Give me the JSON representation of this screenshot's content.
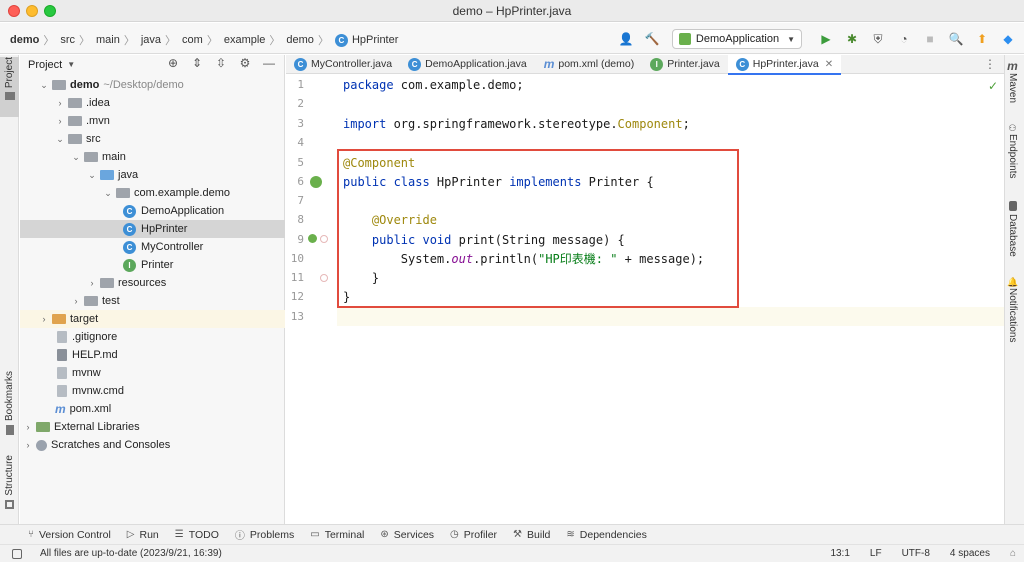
{
  "window": {
    "title": "demo – HpPrinter.java"
  },
  "breadcrumbs": [
    "demo",
    "src",
    "main",
    "java",
    "com",
    "example",
    "demo"
  ],
  "breadcrumb_file": "HpPrinter",
  "toolbar": {
    "run_config": "DemoApplication"
  },
  "left_strip": {
    "project": "Project",
    "bookmarks": "Bookmarks",
    "structure": "Structure"
  },
  "project_panel": {
    "title": "Project",
    "tree": [
      {
        "label": "demo",
        "extra": "~/Desktop/demo"
      },
      {
        "label": ".idea"
      },
      {
        "label": ".mvn"
      },
      {
        "label": "src"
      },
      {
        "label": "main"
      },
      {
        "label": "java"
      },
      {
        "label": "com.example.demo"
      },
      {
        "label": "DemoApplication"
      },
      {
        "label": "HpPrinter"
      },
      {
        "label": "MyController"
      },
      {
        "label": "Printer"
      },
      {
        "label": "resources"
      },
      {
        "label": "test"
      },
      {
        "label": "target"
      },
      {
        "label": ".gitignore"
      },
      {
        "label": "HELP.md"
      },
      {
        "label": "mvnw"
      },
      {
        "label": "mvnw.cmd"
      },
      {
        "label": "pom.xml"
      },
      {
        "label": "External Libraries"
      },
      {
        "label": "Scratches and Consoles"
      }
    ]
  },
  "editor": {
    "tabs": [
      "MyController.java",
      "DemoApplication.java",
      "pom.xml (demo)",
      "Printer.java",
      "HpPrinter.java"
    ],
    "line_numbers": [
      "1",
      "2",
      "3",
      "4",
      "5",
      "6",
      "7",
      "8",
      "9",
      "10",
      "11",
      "12",
      "13"
    ],
    "code": {
      "l1a": "package",
      "l1b": " com.example.demo;",
      "l3a": "import",
      "l3b": " org.springframework.stereotype.",
      "l3c": "Component",
      "l3d": ";",
      "l5": "@Component",
      "l6a": "public class",
      "l6b": " HpPrinter ",
      "l6c": "implements",
      "l6d": " Printer {",
      "l8": "    @Override",
      "l9a": "    public void",
      "l9b": " print(String message) {",
      "l10a": "        System.",
      "l10b": "out",
      "l10c": ".println(",
      "l10d": "\"HP印表機: \"",
      "l10e": " + message);",
      "l11": "    }",
      "l12": "}"
    }
  },
  "right_strip": {
    "maven": "Maven",
    "endpoints": "Endpoints",
    "database": "Database",
    "notifications": "Notifications"
  },
  "bottom_tools": [
    "Version Control",
    "Run",
    "TODO",
    "Problems",
    "Terminal",
    "Services",
    "Profiler",
    "Build",
    "Dependencies"
  ],
  "status": {
    "message": "All files are up-to-date (2023/9/21, 16:39)",
    "position": "13:1",
    "line_sep": "LF",
    "encoding": "UTF-8",
    "indent": "4 spaces"
  }
}
